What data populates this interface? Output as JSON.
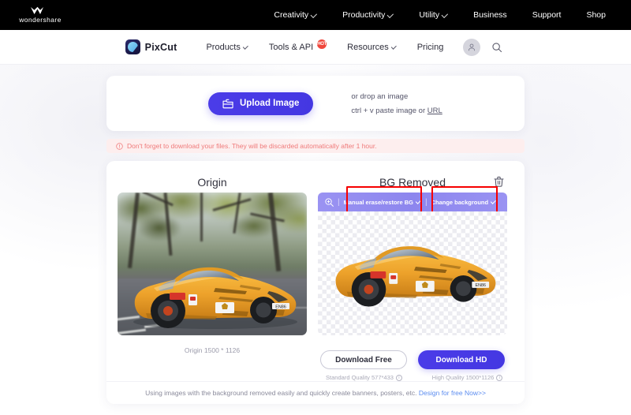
{
  "topbar": {
    "brand": "wondershare",
    "logo_icon": "wondershare-w-icon",
    "nav": [
      {
        "label": "Creativity",
        "has_caret": true
      },
      {
        "label": "Productivity",
        "has_caret": true
      },
      {
        "label": "Utility",
        "has_caret": true
      },
      {
        "label": "Business",
        "has_caret": false
      },
      {
        "label": "Support",
        "has_caret": false
      },
      {
        "label": "Shop",
        "has_caret": false
      }
    ]
  },
  "subnav": {
    "brand_name": "PixCut",
    "brand_logo_icon": "pixcut-logo-icon",
    "items": [
      {
        "label": "Products",
        "has_caret": true,
        "badge": ""
      },
      {
        "label": "Tools & API",
        "has_caret": false,
        "badge": "HOT"
      },
      {
        "label": "Resources",
        "has_caret": true,
        "badge": ""
      },
      {
        "label": "Pricing",
        "has_caret": false,
        "badge": ""
      }
    ],
    "account_icon": "user-avatar-icon",
    "search_icon": "search-icon"
  },
  "upload": {
    "button_label": "Upload Image",
    "button_icon": "folder-upload-icon",
    "drop_hint": "or drop an image",
    "paste_hint_prefix": "ctrl + v paste image or ",
    "paste_hint_link": "URL"
  },
  "warning": {
    "icon": "info-circle-icon",
    "text": "Don't forget to download your files. They will be discarded automatically after 1 hour."
  },
  "editor": {
    "origin": {
      "title": "Origin",
      "caption": "Origin 1500 * 1126",
      "image_alt": "yellow-ferrari-458-speciale-on-tree-lined-road"
    },
    "bg_removed": {
      "title": "BG Removed",
      "delete_icon": "trash-icon",
      "toolbar": {
        "zoom_icon": "zoom-in-icon",
        "separator": "|",
        "items": [
          {
            "label": "Manual erase/restore BG",
            "has_caret": true,
            "highlighted": true
          },
          {
            "label": "Change background",
            "has_caret": true,
            "highlighted": true
          }
        ]
      },
      "image_alt": "yellow-ferrari-458-speciale-background-removed"
    },
    "downloads": [
      {
        "label": "Download Free",
        "style": "outline",
        "quality": "Standard Quality 577*433",
        "info_icon": "info-circle-icon"
      },
      {
        "label": "Download HD",
        "style": "primary",
        "quality": "High Quality 1500*1126",
        "info_icon": "info-circle-icon"
      }
    ]
  },
  "card_footer": {
    "text": "Using images with the background removed easily and quickly create banners, posters, etc. ",
    "link": "Design for free Now>>"
  },
  "colors": {
    "accent": "#4b3ce8",
    "toolbar": "#9a93f2",
    "highlight": "#f60000",
    "warning_bg": "#fdeeee",
    "warning_text": "#ef7a7a",
    "link": "#5b8cf0"
  }
}
